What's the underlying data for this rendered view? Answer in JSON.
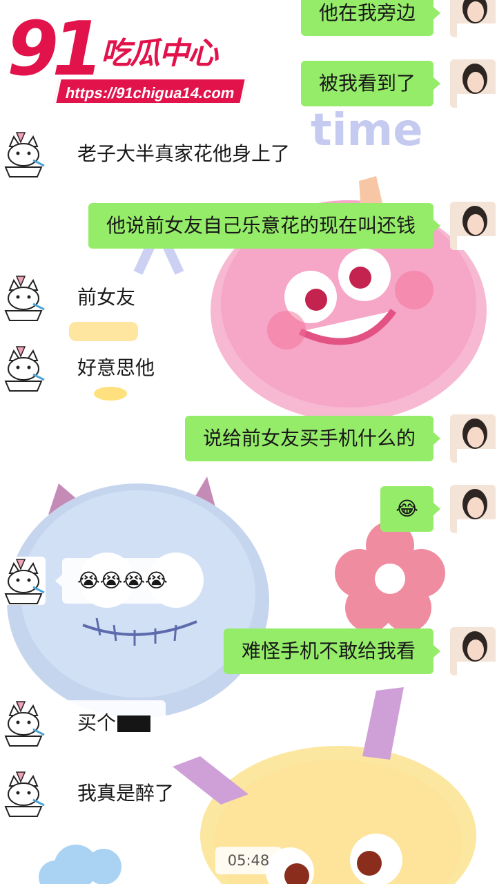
{
  "watermark": {
    "logo_number": "91",
    "logo_name": "吃瓜中心",
    "url": "https://91chigua14.com"
  },
  "background": {
    "deco_text": "time"
  },
  "messages": [
    {
      "side": "right",
      "text": "他在我旁边"
    },
    {
      "side": "right",
      "text": "被我看到了"
    },
    {
      "side": "left",
      "text": "老子大半真家花他身上了"
    },
    {
      "side": "right",
      "text": "他说前女友自己乐意花的现在叫还钱"
    },
    {
      "side": "left",
      "text": "前女友"
    },
    {
      "side": "left",
      "text": "好意思他"
    },
    {
      "side": "right",
      "text": "说给前女友买手机什么的"
    },
    {
      "side": "right",
      "text": "😂"
    },
    {
      "side": "left",
      "text": "😭😭😭😭"
    },
    {
      "side": "right",
      "text": "难怪手机不敢给我看"
    },
    {
      "side": "left",
      "text": "买个"
    },
    {
      "side": "left",
      "text": "我真是醉了"
    }
  ],
  "timestamp": "05:48",
  "colors": {
    "right_bubble": "#95ec69",
    "left_bubble": "#ffffff",
    "watermark_red": "#e2124b"
  },
  "icons": {
    "left_avatar": "cat-avatar-icon",
    "right_avatar": "girl-photo-avatar"
  }
}
